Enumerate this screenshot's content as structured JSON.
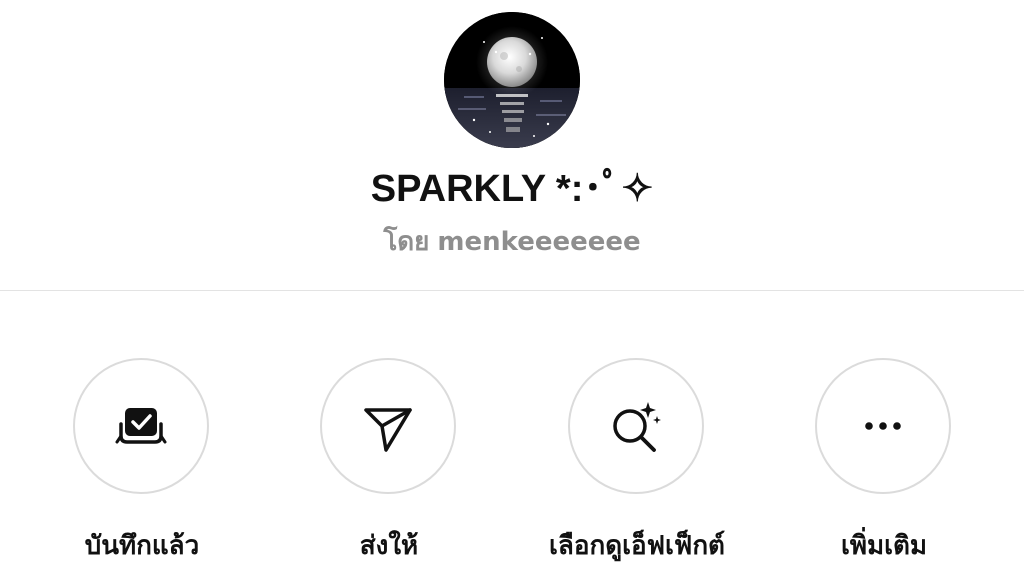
{
  "effect": {
    "title": "SPARKLY *:･ﾟ✧",
    "creator_prefix": "โดย",
    "creator_name": "menkeeeeeee"
  },
  "actions": [
    {
      "label": "บันทึกแล้ว",
      "icon": "saved-check-icon"
    },
    {
      "label": "ส่งให้",
      "icon": "send-paper-plane-icon"
    },
    {
      "label": "เลือกดูเอ็ฟเฟ็กต์",
      "icon": "browse-effects-search-sparkle-icon"
    },
    {
      "label": "เพิ่มเติม",
      "icon": "more-dots-icon"
    }
  ],
  "colors": {
    "text": "#111111",
    "secondary_text": "#8e8e8e",
    "circle_border": "#dbdbdb",
    "divider": "#e3e3e3"
  }
}
